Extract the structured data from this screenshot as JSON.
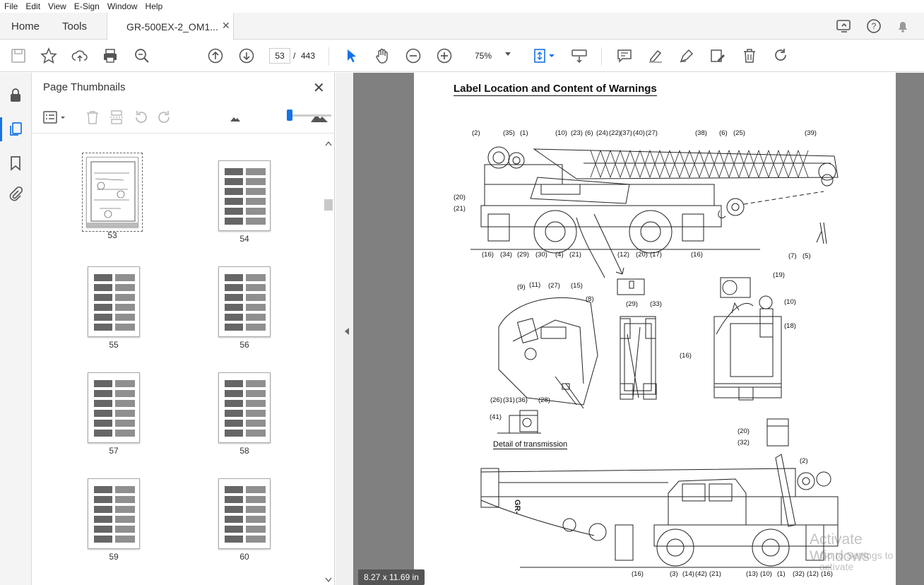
{
  "menu": [
    "File",
    "Edit",
    "View",
    "E-Sign",
    "Window",
    "Help"
  ],
  "tabs": {
    "home": "Home",
    "tools": "Tools",
    "document": "GR-500EX-2_OM1...",
    "close": "✕"
  },
  "toolbar": {
    "page_current": "53",
    "page_sep": "/",
    "page_total": "443",
    "zoom": "75%"
  },
  "thumbnail_panel": {
    "title": "Page Thumbnails",
    "close": "✕",
    "thumbnails": [
      {
        "label": "53",
        "selected": true
      },
      {
        "label": "54"
      },
      {
        "label": "55"
      },
      {
        "label": "56"
      },
      {
        "label": "57"
      },
      {
        "label": "58"
      },
      {
        "label": "59"
      },
      {
        "label": "60"
      }
    ]
  },
  "document": {
    "title": "Label Location and Content of Warnings",
    "detail_caption": "Detail of transmission",
    "side_code": "GR-",
    "page_size": "8.27 x 11.69 in",
    "callouts_top": [
      "(2)",
      "(35)",
      "(1)",
      "(10)",
      "(23)",
      "(6)",
      "(24)",
      "(22)",
      "(37)",
      "(40)",
      "(27)",
      "(38)",
      "(6)",
      "(25)",
      "(39)",
      "(20)",
      "(21)",
      "(16)",
      "(34)",
      "(29)",
      "(30)",
      "(4)",
      "(21)",
      "(12)",
      "(20)",
      "(17)",
      "(16)",
      "(7)",
      "(5)"
    ],
    "callouts_mid": [
      "(9)",
      "(11)",
      "(27)",
      "(15)",
      "(8)",
      "(26)",
      "(31)",
      "(36)",
      "(28)",
      "(29)",
      "(33)",
      "(16)",
      "(19)",
      "(10)",
      "(18)",
      "(41)",
      "(20)",
      "(32)"
    ],
    "callouts_bottom": [
      "(2)",
      "(16)",
      "(3)",
      "(14)",
      "(42)",
      "(21)",
      "(13)",
      "(10)",
      "(1)",
      "(32)",
      "(12)",
      "(16)"
    ]
  },
  "watermark": {
    "line1": "Activate Windows",
    "line2": "Go to Settings to activate"
  }
}
